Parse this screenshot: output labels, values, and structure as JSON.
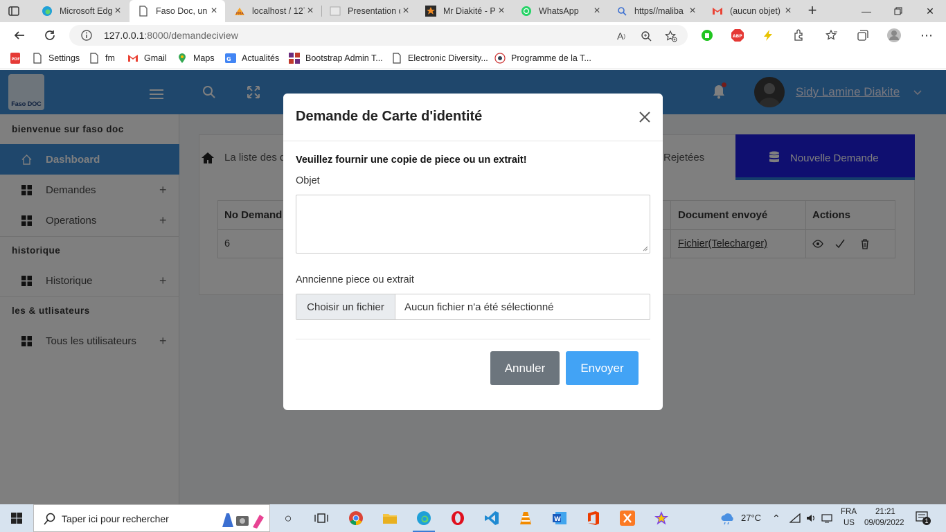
{
  "browser": {
    "tabs": [
      {
        "title": "Microsoft Edge",
        "active": false
      },
      {
        "title": "Faso Doc, un re",
        "active": true
      },
      {
        "title": "localhost / 127",
        "active": false
      },
      {
        "title": "Presentation de",
        "active": false
      },
      {
        "title": "Mr Diakité - Pr",
        "active": false
      },
      {
        "title": "WhatsApp",
        "active": false
      },
      {
        "title": "https//maliba",
        "active": false
      },
      {
        "title": "(aucun objet) -",
        "active": false
      }
    ],
    "url_host": "127.0.0.1",
    "url_path": ":8000/demandeciview",
    "bookmarks": [
      "Settings",
      "fm",
      "Gmail",
      "Maps",
      "Actualités",
      "Bootstrap Admin T...",
      "Electronic Diversity...",
      "Programme de la T..."
    ]
  },
  "app": {
    "logo_text": "Faso DOC",
    "user_name": "Sidy Lamine Diakite",
    "sidebar": {
      "heading_welcome": "bienvenue sur faso doc",
      "heading_history": "historique",
      "heading_users": "les & utlisateurs",
      "items": [
        {
          "label": "Dashboard"
        },
        {
          "label": "Demandes"
        },
        {
          "label": "Operations"
        },
        {
          "label": "Historique"
        },
        {
          "label": "Tous les utilisateurs"
        }
      ]
    },
    "content": {
      "tab_list_label": "La liste des d",
      "tab_rejected": "Rejetées",
      "tab_new": "Nouvelle Demande",
      "table": {
        "headers": [
          "No Demand",
          "Document envoyé",
          "Actions"
        ],
        "row": {
          "no": "6",
          "document": "Fichier(Telecharger)"
        }
      }
    }
  },
  "modal": {
    "title": "Demande de Carte d'identité",
    "note": "Veuillez fournir une copie de piece ou un extrait!",
    "objet_label": "Objet",
    "objet_value": "",
    "file_label": "Anncienne piece ou extrait",
    "file_button": "Choisir un fichier",
    "file_status": "Aucun fichier n'a été sélectionné",
    "cancel": "Annuler",
    "send": "Envoyer"
  },
  "taskbar": {
    "search_placeholder": "Taper ici pour rechercher",
    "weather": "27°C",
    "lang": "FRA",
    "layout": "US",
    "time": "21:21",
    "date": "09/09/2022",
    "notification_count": "1"
  },
  "colors": {
    "accent": "#3f8ed8",
    "new_tab": "#1f1fe0",
    "send": "#42a3f5",
    "cancel": "#6c757d"
  }
}
